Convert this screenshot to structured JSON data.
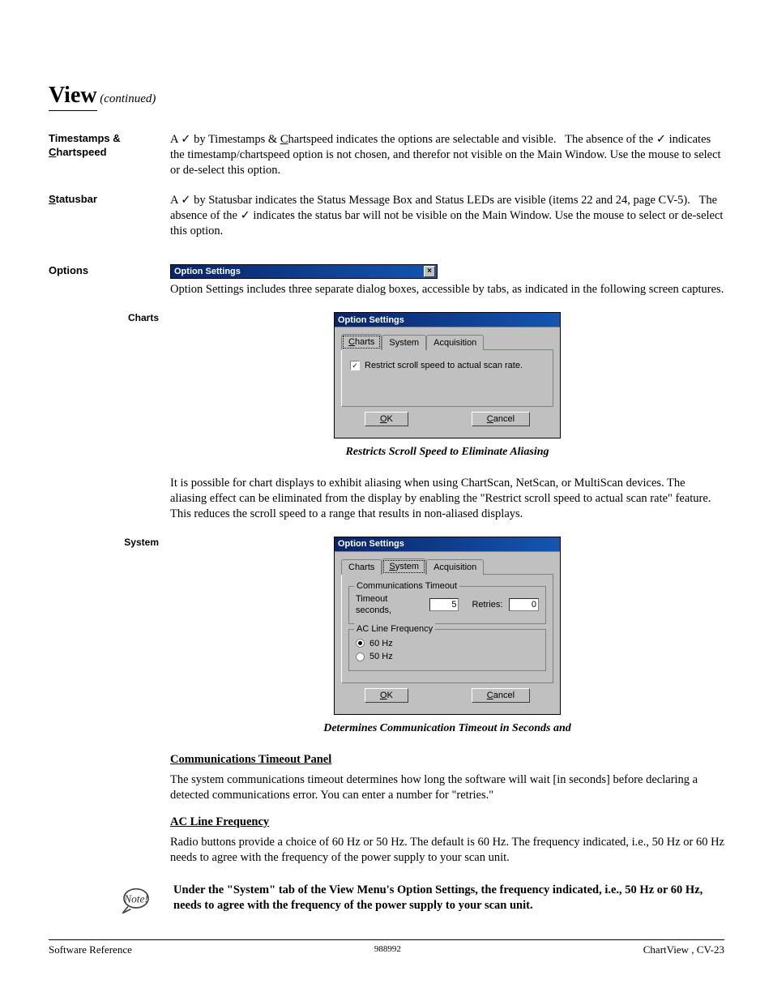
{
  "heading": {
    "title": "View",
    "continued": "(continued)"
  },
  "sections": {
    "timestamps_label_html": "Timestamps & Chartspeed",
    "timestamps_text": "A ✓ by Timestamps & Chartspeed indicates the options are selectable and visible.   The absence of the ✓ indicates the timestamp/chartspeed option is not chosen, and therefor not visible on the Main Window. Use the mouse to select or de-select this option.",
    "statusbar_label": "Statusbar",
    "statusbar_text": "A ✓ by Statusbar indicates the Status Message Box and Status LEDs are visible (items 22 and 24, page CV-5).   The absence of the ✓ indicates the status bar will not be visible on the Main Window. Use the mouse to select or de-select this option.",
    "options_label": "Options",
    "options_intro": "Option Settings includes three separate dialog boxes, accessible by tabs, as indicated in the following screen captures."
  },
  "titlebar_text": "Option Settings",
  "charts": {
    "side_label": "Charts",
    "tabs": {
      "charts": "Charts",
      "system": "System",
      "acquisition": "Acquisition"
    },
    "checkbox_label": "Restrict scroll speed to actual scan rate.",
    "ok": "OK",
    "cancel": "Cancel",
    "caption": "Restricts Scroll Speed to Eliminate Aliasing",
    "para": "It is possible for chart displays to exhibit aliasing when using ChartScan, NetScan, or MultiScan devices.  The aliasing effect can be eliminated from the display by enabling the  \"Restrict scroll speed to actual scan rate\" feature.  This reduces the scroll speed to a range that results in non-aliased displays."
  },
  "system": {
    "side_label": "System",
    "tabs": {
      "charts": "Charts",
      "system": "System",
      "acquisition": "Acquisition"
    },
    "group1_title": "Communications Timeout",
    "timeout_label": "Timeout seconds,",
    "timeout_value": "5",
    "retries_label": "Retries:",
    "retries_value": "0",
    "group2_title": "AC Line Frequency",
    "opt60": "60 Hz",
    "opt50": "50 Hz",
    "ok": "OK",
    "cancel": "Cancel",
    "caption": "Determines Communication Timeout in Seconds and",
    "sub1": "Communications Timeout Panel",
    "para1": "The system communications timeout determines how long the software will wait [in seconds] before declaring a detected communications error.   You can enter a number for \"retries.\"",
    "sub2": "AC Line Frequency",
    "para2": "Radio buttons provide a choice of 60 Hz or 50 Hz.  The default is 60 Hz.  The frequency indicated, i.e., 50 Hz or 60 Hz needs to agree with the frequency of the power supply to your scan unit."
  },
  "note": "Under the \"System\" tab of the View Menu's Option Settings, the frequency indicated, i.e., 50 Hz or 60 Hz, needs to agree with the frequency of the power supply to your scan unit.",
  "footer": {
    "left": "Software Reference",
    "mid": "988992",
    "right": "ChartView , CV-23"
  }
}
